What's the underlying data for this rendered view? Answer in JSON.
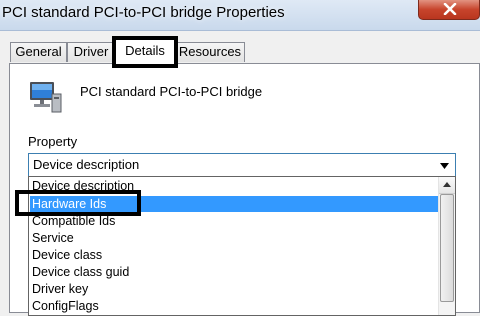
{
  "window": {
    "title": "PCI standard PCI-to-PCI bridge Properties"
  },
  "tabs": [
    {
      "label": "General"
    },
    {
      "label": "Driver"
    },
    {
      "label": "Details"
    },
    {
      "label": "Resources"
    }
  ],
  "active_tab": "Details",
  "device": {
    "icon": "monitor-computer-icon",
    "name": "PCI standard PCI-to-PCI bridge"
  },
  "property": {
    "label": "Property",
    "selected_value": "Device description",
    "options": [
      {
        "label": "Device description"
      },
      {
        "label": "Hardware Ids"
      },
      {
        "label": "Compatible Ids"
      },
      {
        "label": "Service"
      },
      {
        "label": "Device class"
      },
      {
        "label": "Device class guid"
      },
      {
        "label": "Driver key"
      },
      {
        "label": "ConfigFlags"
      }
    ],
    "highlighted_option": "Hardware Ids"
  },
  "colors": {
    "selection": "#3399ff",
    "close_button": "#c7442c",
    "callout_border": "#000000"
  }
}
